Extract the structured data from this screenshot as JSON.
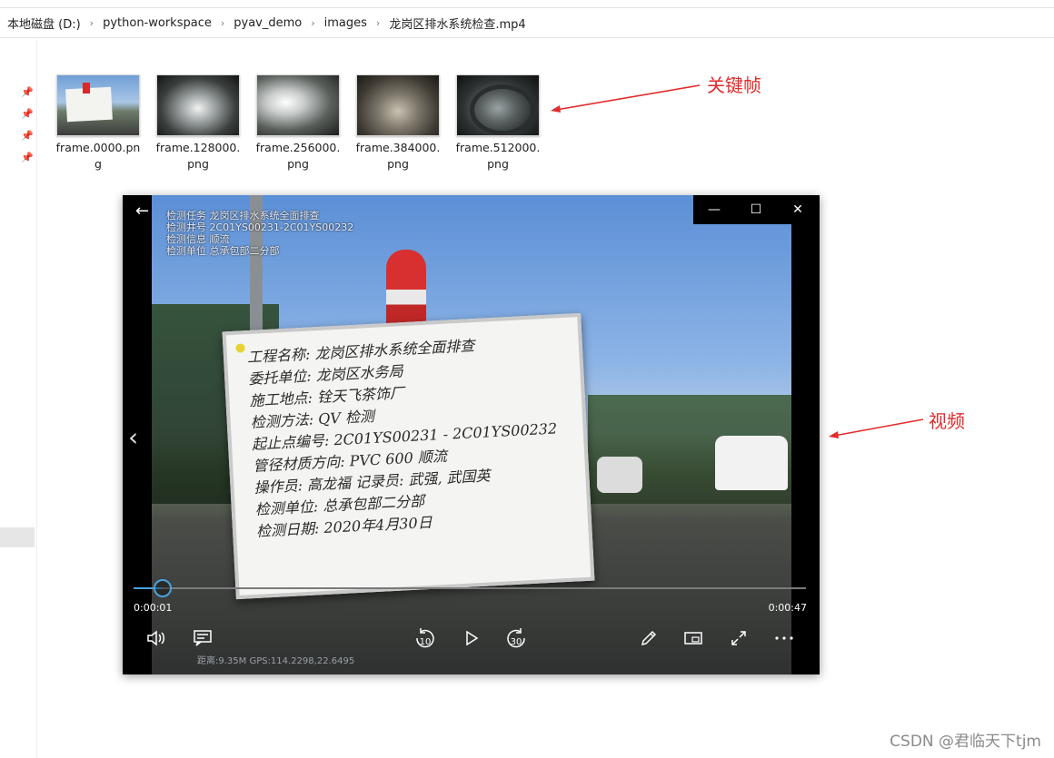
{
  "breadcrumb": [
    "本地磁盘 (D:)",
    "python-workspace",
    "pyav_demo",
    "images",
    "龙岗区排水系统检查.mp4"
  ],
  "files": [
    {
      "name": "frame.0000.png",
      "icon": "image-thumbnail"
    },
    {
      "name": "frame.128000.png",
      "icon": "image-thumbnail"
    },
    {
      "name": "frame.256000.png",
      "icon": "image-thumbnail"
    },
    {
      "name": "frame.384000.png",
      "icon": "image-thumbnail"
    },
    {
      "name": "frame.512000.png",
      "icon": "image-thumbnail"
    }
  ],
  "annotations": {
    "keyframes": "关键帧",
    "video": "视频"
  },
  "player": {
    "overlay": [
      "检测任务 龙岗区排水系统全面排查",
      "检测井号 2C01YS00231-2C01YS00232",
      "检测信息 顺流",
      "检测单位 总承包部二分部"
    ],
    "overlay_year": "2020",
    "board_lines": [
      "工程名称: 龙岗区排水系统全面排查",
      "委托单位: 龙岗区水务局",
      "施工地点: 铨天飞茶饰厂",
      "检测方法: QV 检测",
      "起止点编号: 2C01YS00231 - 2C01YS00232",
      "管径材质方向: PVC 600  顺流",
      "操作员: 高龙福  记录员: 武强, 武国英",
      "检测单位: 总承包部二分部",
      "检测日期: 2020年4月30日"
    ],
    "current_time": "0:00:01",
    "duration": "0:00:47",
    "progress_fraction": 0.02,
    "bottom_overlay": "距离:9.35M        GPS:114.2298,22.6495",
    "skip_back_label": "10",
    "skip_forward_label": "30"
  },
  "watermark": "CSDN @君临天下tjm",
  "colors": {
    "annotation": "#e32b2b",
    "seek": "#4aa3df"
  }
}
